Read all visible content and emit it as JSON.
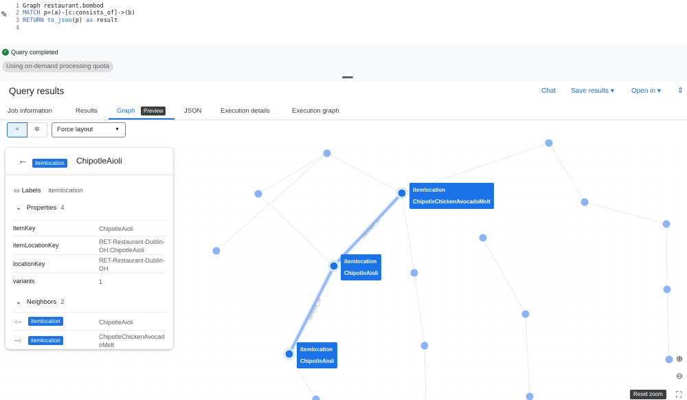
{
  "editor": {
    "lines": [
      {
        "num": "1",
        "parts": [
          {
            "t": "Graph restaurant.bombod",
            "c": "code-txt"
          }
        ]
      },
      {
        "num": "2",
        "parts": [
          {
            "t": "MATCH ",
            "c": "kw"
          },
          {
            "t": "p=(a)-[c:consists_of]->(b)",
            "c": "code-txt"
          }
        ]
      },
      {
        "num": "3",
        "parts": [
          {
            "t": "RETURN ",
            "c": "kw"
          },
          {
            "t": "to_json",
            "c": "fn"
          },
          {
            "t": "(p) ",
            "c": "code-txt"
          },
          {
            "t": "as ",
            "c": "kw"
          },
          {
            "t": "result",
            "c": "code-txt"
          }
        ]
      },
      {
        "num": "4",
        "parts": []
      }
    ]
  },
  "status": {
    "text": "Query completed",
    "quota": "Using on-demand processing quota"
  },
  "results": {
    "title": "Query results",
    "chat": "Chat",
    "save": "Save results",
    "open": "Open in",
    "tabs": [
      "Job information",
      "Results",
      "Graph",
      "JSON",
      "Execution details",
      "Execution graph"
    ],
    "preview": "Preview"
  },
  "toolbar": {
    "layout": "Force layout"
  },
  "panel": {
    "chip": "itemlocation",
    "title": "ChipotleAioli",
    "labels_title": "Labels",
    "labels_value": "itemlocation",
    "properties_title": "Properties",
    "properties_count": "4",
    "properties": [
      {
        "key": "itemKey",
        "value": "ChipotleAioli"
      },
      {
        "key": "itemLocationKey",
        "value": "RET-Restaurant-Dublin-OH:ChipotleAioli"
      },
      {
        "key": "locationKey",
        "value": "RET-Restaurant-Dublin-OH"
      },
      {
        "key": "variants",
        "value": "1"
      }
    ],
    "neighbors_title": "Neighbors",
    "neighbors_count": "2",
    "neighbors": [
      {
        "chip": "itemlocation",
        "value": "ChipotleAioli"
      },
      {
        "chip": "itemlocation",
        "value": "ChipotleChickenAvocadoMelt"
      }
    ]
  },
  "graph": {
    "node_labels": [
      {
        "type": "itemlocation",
        "name": "ChipotleChickenAvocadoMelt"
      },
      {
        "type": "itemlocation",
        "name": "ChipotleAioli"
      },
      {
        "type": "itemlocation",
        "name": "ChipotleAioli"
      }
    ],
    "edge_label": "consists_of"
  },
  "zoom": {
    "reset": "Reset zoom"
  },
  "colors": {
    "accent": "#1a73e8",
    "node": "#8ab4f8",
    "selected": "#1a73e8"
  }
}
